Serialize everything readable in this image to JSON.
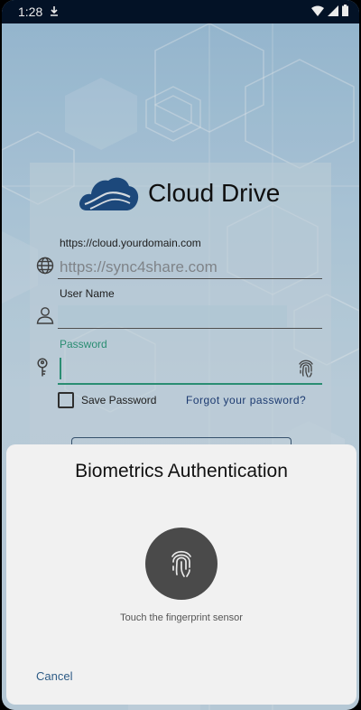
{
  "status_bar": {
    "time": "1:28",
    "notification_icon": "download-icon",
    "wifi_icon": "wifi-icon",
    "signal_icon": "signal-icon",
    "battery_icon": "battery-icon"
  },
  "login": {
    "app_name": "Cloud Drive",
    "server": {
      "label": "https://cloud.yourdomain.com",
      "placeholder": "https://sync4share.com",
      "icon": "globe-icon"
    },
    "username": {
      "label": "User Name",
      "value": "",
      "icon": "person-icon"
    },
    "password": {
      "label": "Password",
      "value": "",
      "icon": "key-icon",
      "trailing_icon": "fingerprint-icon"
    },
    "save_password_label": "Save Password",
    "save_password_checked": false,
    "forgot_password_label": "Forgot your password?"
  },
  "biometric_dialog": {
    "title": "Biometrics Authentication",
    "icon": "fingerprint-icon",
    "hint": "Touch the fingerprint sensor",
    "cancel_label": "Cancel"
  },
  "colors": {
    "status_bar": "#04142a",
    "logo_cloud": "#1f4f86",
    "focus_accent": "#2e9a7c",
    "link": "#1f3f7a",
    "cancel": "#2e5c86",
    "sheet_bg": "#f1f1f1"
  }
}
